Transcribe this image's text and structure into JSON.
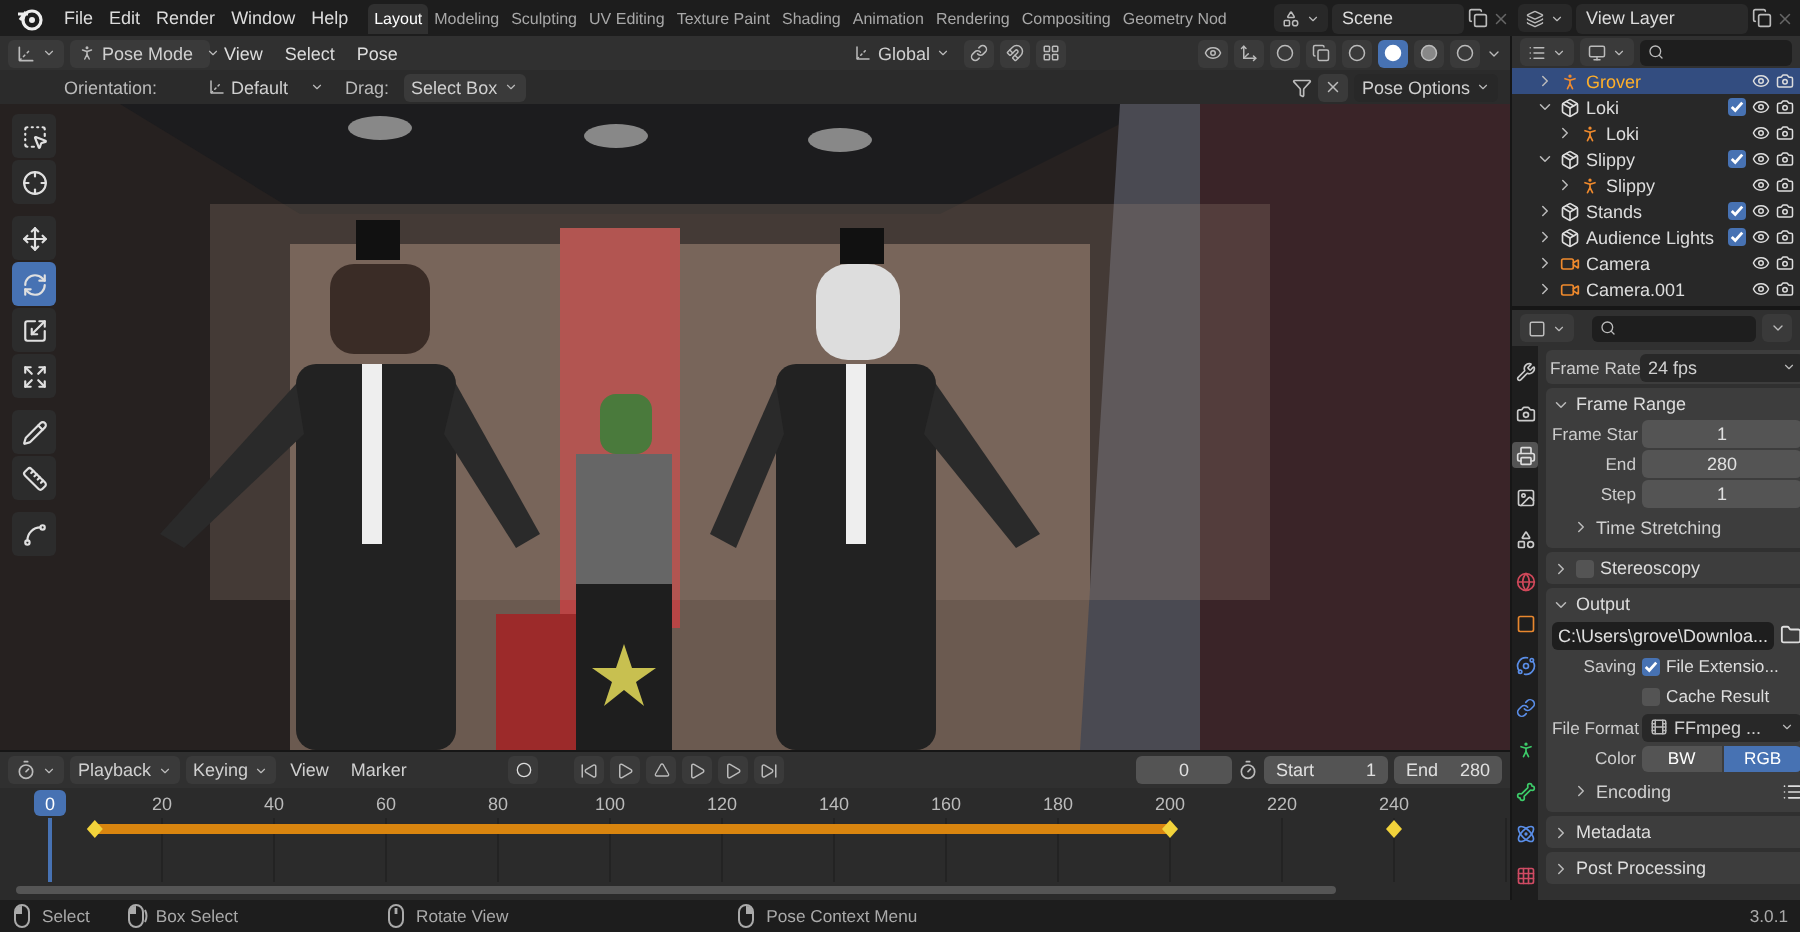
{
  "menu": [
    "File",
    "Edit",
    "Render",
    "Window",
    "Help"
  ],
  "workspaces": [
    {
      "label": "Layout",
      "selected": true
    },
    {
      "label": "Modeling",
      "selected": false
    },
    {
      "label": "Sculpting",
      "selected": false
    },
    {
      "label": "UV Editing",
      "selected": false
    },
    {
      "label": "Texture Paint",
      "selected": false
    },
    {
      "label": "Shading",
      "selected": false
    },
    {
      "label": "Animation",
      "selected": false
    },
    {
      "label": "Rendering",
      "selected": false
    },
    {
      "label": "Compositing",
      "selected": false
    },
    {
      "label": "Geometry Nod",
      "selected": false
    }
  ],
  "scene": "Scene",
  "view_layer": "View Layer",
  "viewport_header": {
    "mode": "Pose Mode",
    "menus": [
      "View",
      "Select",
      "Pose"
    ],
    "orientation": "Global",
    "shading_modes": [
      {
        "kind": "wireframe",
        "selected": false
      },
      {
        "kind": "solid",
        "selected": true
      },
      {
        "kind": "material",
        "selected": false
      },
      {
        "kind": "rendered",
        "selected": false
      }
    ]
  },
  "tool_settings": {
    "orientation_label": "Orientation:",
    "orientation": "Default",
    "drag_label": "Drag:",
    "drag": "Select Box",
    "options": "Pose Options"
  },
  "tools": [
    {
      "kind": "select_box",
      "selected": false
    },
    {
      "kind": "cursor",
      "selected": false
    },
    {
      "kind": "move",
      "selected": false
    },
    {
      "kind": "rotate",
      "selected": true
    },
    {
      "kind": "scale",
      "selected": false
    },
    {
      "kind": "transform",
      "selected": false
    },
    {
      "kind": "annotate",
      "selected": false
    },
    {
      "kind": "measure",
      "selected": false
    },
    {
      "kind": "roll",
      "selected": false
    }
  ],
  "outliner": {
    "items": [
      {
        "name": "Grover",
        "kind": "armature",
        "selected": true,
        "expanded": false
      },
      {
        "name": "Loki",
        "kind": "collection",
        "selected": false,
        "checked": true,
        "expanded": true,
        "children": [
          {
            "name": "Loki",
            "kind": "armature",
            "selected": false,
            "expanded": false
          }
        ]
      },
      {
        "name": "Slippy",
        "kind": "collection",
        "selected": false,
        "checked": true,
        "expanded": true,
        "children": [
          {
            "name": "Slippy",
            "kind": "armature",
            "selected": false,
            "expanded": false
          }
        ]
      },
      {
        "name": "Stands",
        "kind": "collection",
        "selected": false,
        "checked": true,
        "expanded": false
      },
      {
        "name": "Audience Lights",
        "kind": "collection",
        "selected": false,
        "checked": true,
        "expanded": false
      },
      {
        "name": "Camera",
        "kind": "camera",
        "selected": false,
        "expanded": false
      },
      {
        "name": "Camera.001",
        "kind": "camera",
        "selected": false,
        "expanded": false
      }
    ]
  },
  "property_tabs": [
    {
      "kind": "tool",
      "selected": false
    },
    {
      "kind": "render",
      "selected": false
    },
    {
      "kind": "output",
      "selected": true
    },
    {
      "kind": "view_layer",
      "selected": false
    },
    {
      "kind": "scene",
      "selected": false
    },
    {
      "kind": "world",
      "selected": false
    },
    {
      "kind": "object",
      "selected": false
    },
    {
      "kind": "physics",
      "selected": false
    },
    {
      "kind": "constraints",
      "selected": false
    },
    {
      "kind": "data",
      "selected": false
    },
    {
      "kind": "bone",
      "selected": false
    },
    {
      "kind": "bone_constraint",
      "selected": false
    },
    {
      "kind": "texture",
      "selected": false
    }
  ],
  "properties": {
    "frame_rate": {
      "label": "Frame Rate",
      "value": "24 fps"
    },
    "panels": [
      {
        "title": "Frame Range",
        "expanded": true,
        "rows": [
          {
            "kind": "number",
            "label": "Frame Star",
            "value": "1"
          },
          {
            "kind": "number",
            "label": "End",
            "value": "280"
          },
          {
            "kind": "number",
            "label": "Step",
            "value": "1"
          },
          {
            "kind": "subpanel",
            "title": "Time Stretching",
            "expanded": false
          }
        ]
      },
      {
        "title": "Stereoscopy",
        "expanded": false,
        "checked": false
      },
      {
        "title": "Output",
        "expanded": true,
        "rows": [
          {
            "kind": "path",
            "value": "C:\\Users\\grove\\Downloa..."
          },
          {
            "kind": "checkbox",
            "label": "Saving",
            "text": "File Extensio...",
            "checked": true
          },
          {
            "kind": "checkbox",
            "text": "Cache Result",
            "checked": false
          },
          {
            "kind": "dropdown",
            "label": "File Format",
            "value": "FFmpeg ..."
          },
          {
            "kind": "toggle",
            "label": "Color",
            "options": [
              {
                "label": "BW",
                "selected": false
              },
              {
                "label": "RGB",
                "selected": true
              }
            ]
          },
          {
            "kind": "subpanel",
            "title": "Encoding",
            "expanded": false
          }
        ]
      },
      {
        "title": "Metadata",
        "expanded": false
      },
      {
        "title": "Post Processing",
        "expanded": false
      }
    ]
  },
  "timeline": {
    "menus": [
      "Playback",
      "Keying",
      "View",
      "Marker"
    ],
    "current_frame": "0",
    "start_label": "Start",
    "start": "1",
    "end_label": "End",
    "end": "280",
    "ruler": {
      "current": "0",
      "ticks": [
        "20",
        "40",
        "60",
        "80",
        "100",
        "120",
        "140",
        "160",
        "180",
        "200",
        "220",
        "240"
      ]
    }
  },
  "status_bar": {
    "items": [
      {
        "kind": "left_click",
        "label": "Select"
      },
      {
        "kind": "left_drag",
        "label": "Box Select"
      },
      {
        "kind": "middle",
        "label": "Rotate View"
      },
      {
        "kind": "right_click",
        "label": "Pose Context Menu"
      }
    ],
    "version": "3.0.1"
  }
}
